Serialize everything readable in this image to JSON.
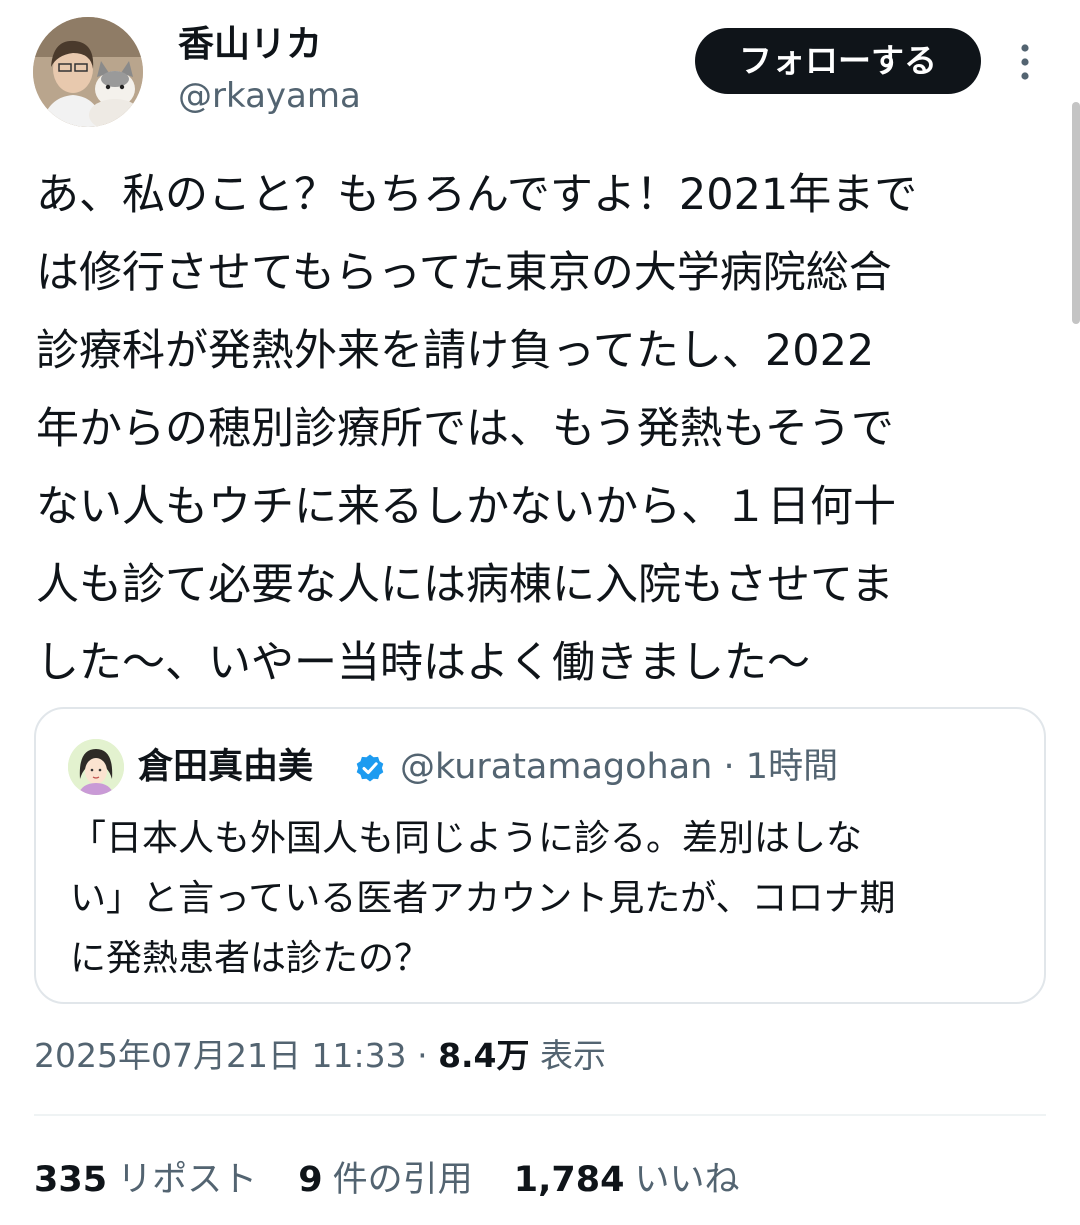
{
  "author": {
    "display_name": "香山リカ",
    "handle": "@rkayama",
    "follow_label": "フォローする"
  },
  "tweet": {
    "lines": [
      "あ、私のこと？もちろんですよ！2021年まで",
      "は修行させてもらってた東京の大学病院総合",
      "診療科が発熱外来を請け負ってたし、2022",
      "年からの穂別診療所では、もう発熱もそうで",
      "ない人もウチに来るしかないから、１日何十",
      "人も診て必要な人には病棟に入院もさせてま",
      "した〜、いやー当時はよく働きました〜"
    ]
  },
  "quote": {
    "display_name": "倉田真由美",
    "handle": "@kuratamagohan",
    "separator": "·",
    "time": "1時間",
    "lines": [
      "「日本人も外国人も同じように診る。差別はしな",
      "い」と言っている医者アカウント見たが、コロナ期",
      "に発熱患者は診たの？"
    ]
  },
  "meta": {
    "timestamp": "2025年07月21日 11:33",
    "separator": "·",
    "views_count": "8.4万",
    "views_label": "表示"
  },
  "stats": {
    "reposts": {
      "count": "335",
      "label": "リポスト"
    },
    "quotes": {
      "count": "9",
      "label": "件の引用"
    },
    "likes": {
      "count": "1,784",
      "label": "いいね"
    }
  },
  "icons": {
    "more": "more-vertical-icon",
    "verified": "verified-badge-icon"
  },
  "colors": {
    "primary_text": "#0f1419",
    "secondary_text": "#536471",
    "verified_blue": "#1d9bf0",
    "follow_button_bg": "#0f1419",
    "border": "#e1e6ea"
  }
}
